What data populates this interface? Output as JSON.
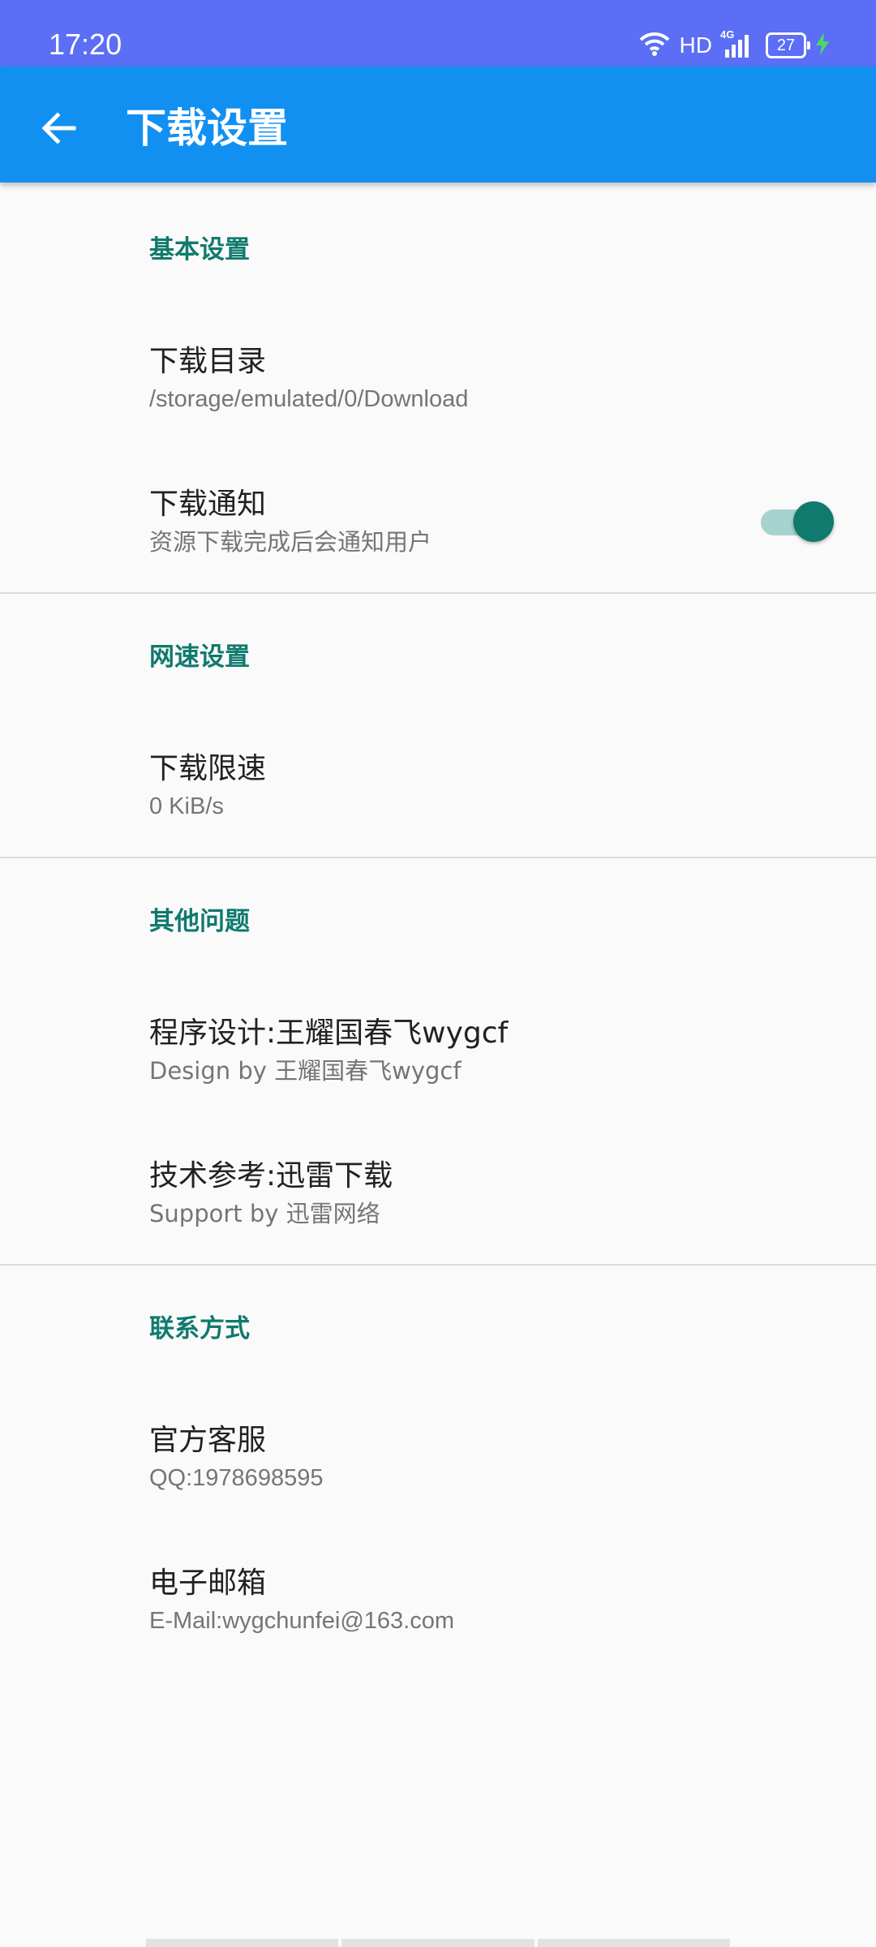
{
  "status_bar": {
    "time": "17:20",
    "network_label": "HD",
    "signal_label": "4G",
    "battery_level": "27",
    "colors": {
      "background": "#5b6ef5",
      "charging": "#4cd964"
    }
  },
  "app_bar": {
    "title": "下载设置",
    "back_icon": "arrow-left-icon",
    "colors": {
      "background": "#1190f2"
    }
  },
  "accent_color": "#0f7a6d",
  "categories": [
    {
      "title": "基本设置",
      "items": [
        {
          "title": "下载目录",
          "summary": "/storage/emulated/0/Download"
        },
        {
          "title": "下载通知",
          "summary": "资源下载完成后会通知用户",
          "switch_on": true
        }
      ]
    },
    {
      "title": "网速设置",
      "items": [
        {
          "title": "下载限速",
          "summary": "0 KiB/s"
        }
      ]
    },
    {
      "title": "其他问题",
      "items": [
        {
          "title": "程序设计:王耀国春飞wygcf",
          "summary": "Design by 王耀国春飞wygcf"
        },
        {
          "title": "技术参考:迅雷下载",
          "summary": "Support by 迅雷网络"
        }
      ]
    },
    {
      "title": "联系方式",
      "items": [
        {
          "title": "官方客服",
          "summary": "QQ:1978698595"
        },
        {
          "title": "电子邮箱",
          "summary": "E-Mail:wygchunfei@163.com"
        }
      ]
    }
  ]
}
